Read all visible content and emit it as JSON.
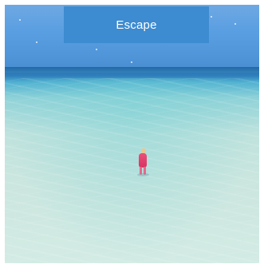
{
  "banner": {
    "title": "Escape"
  }
}
